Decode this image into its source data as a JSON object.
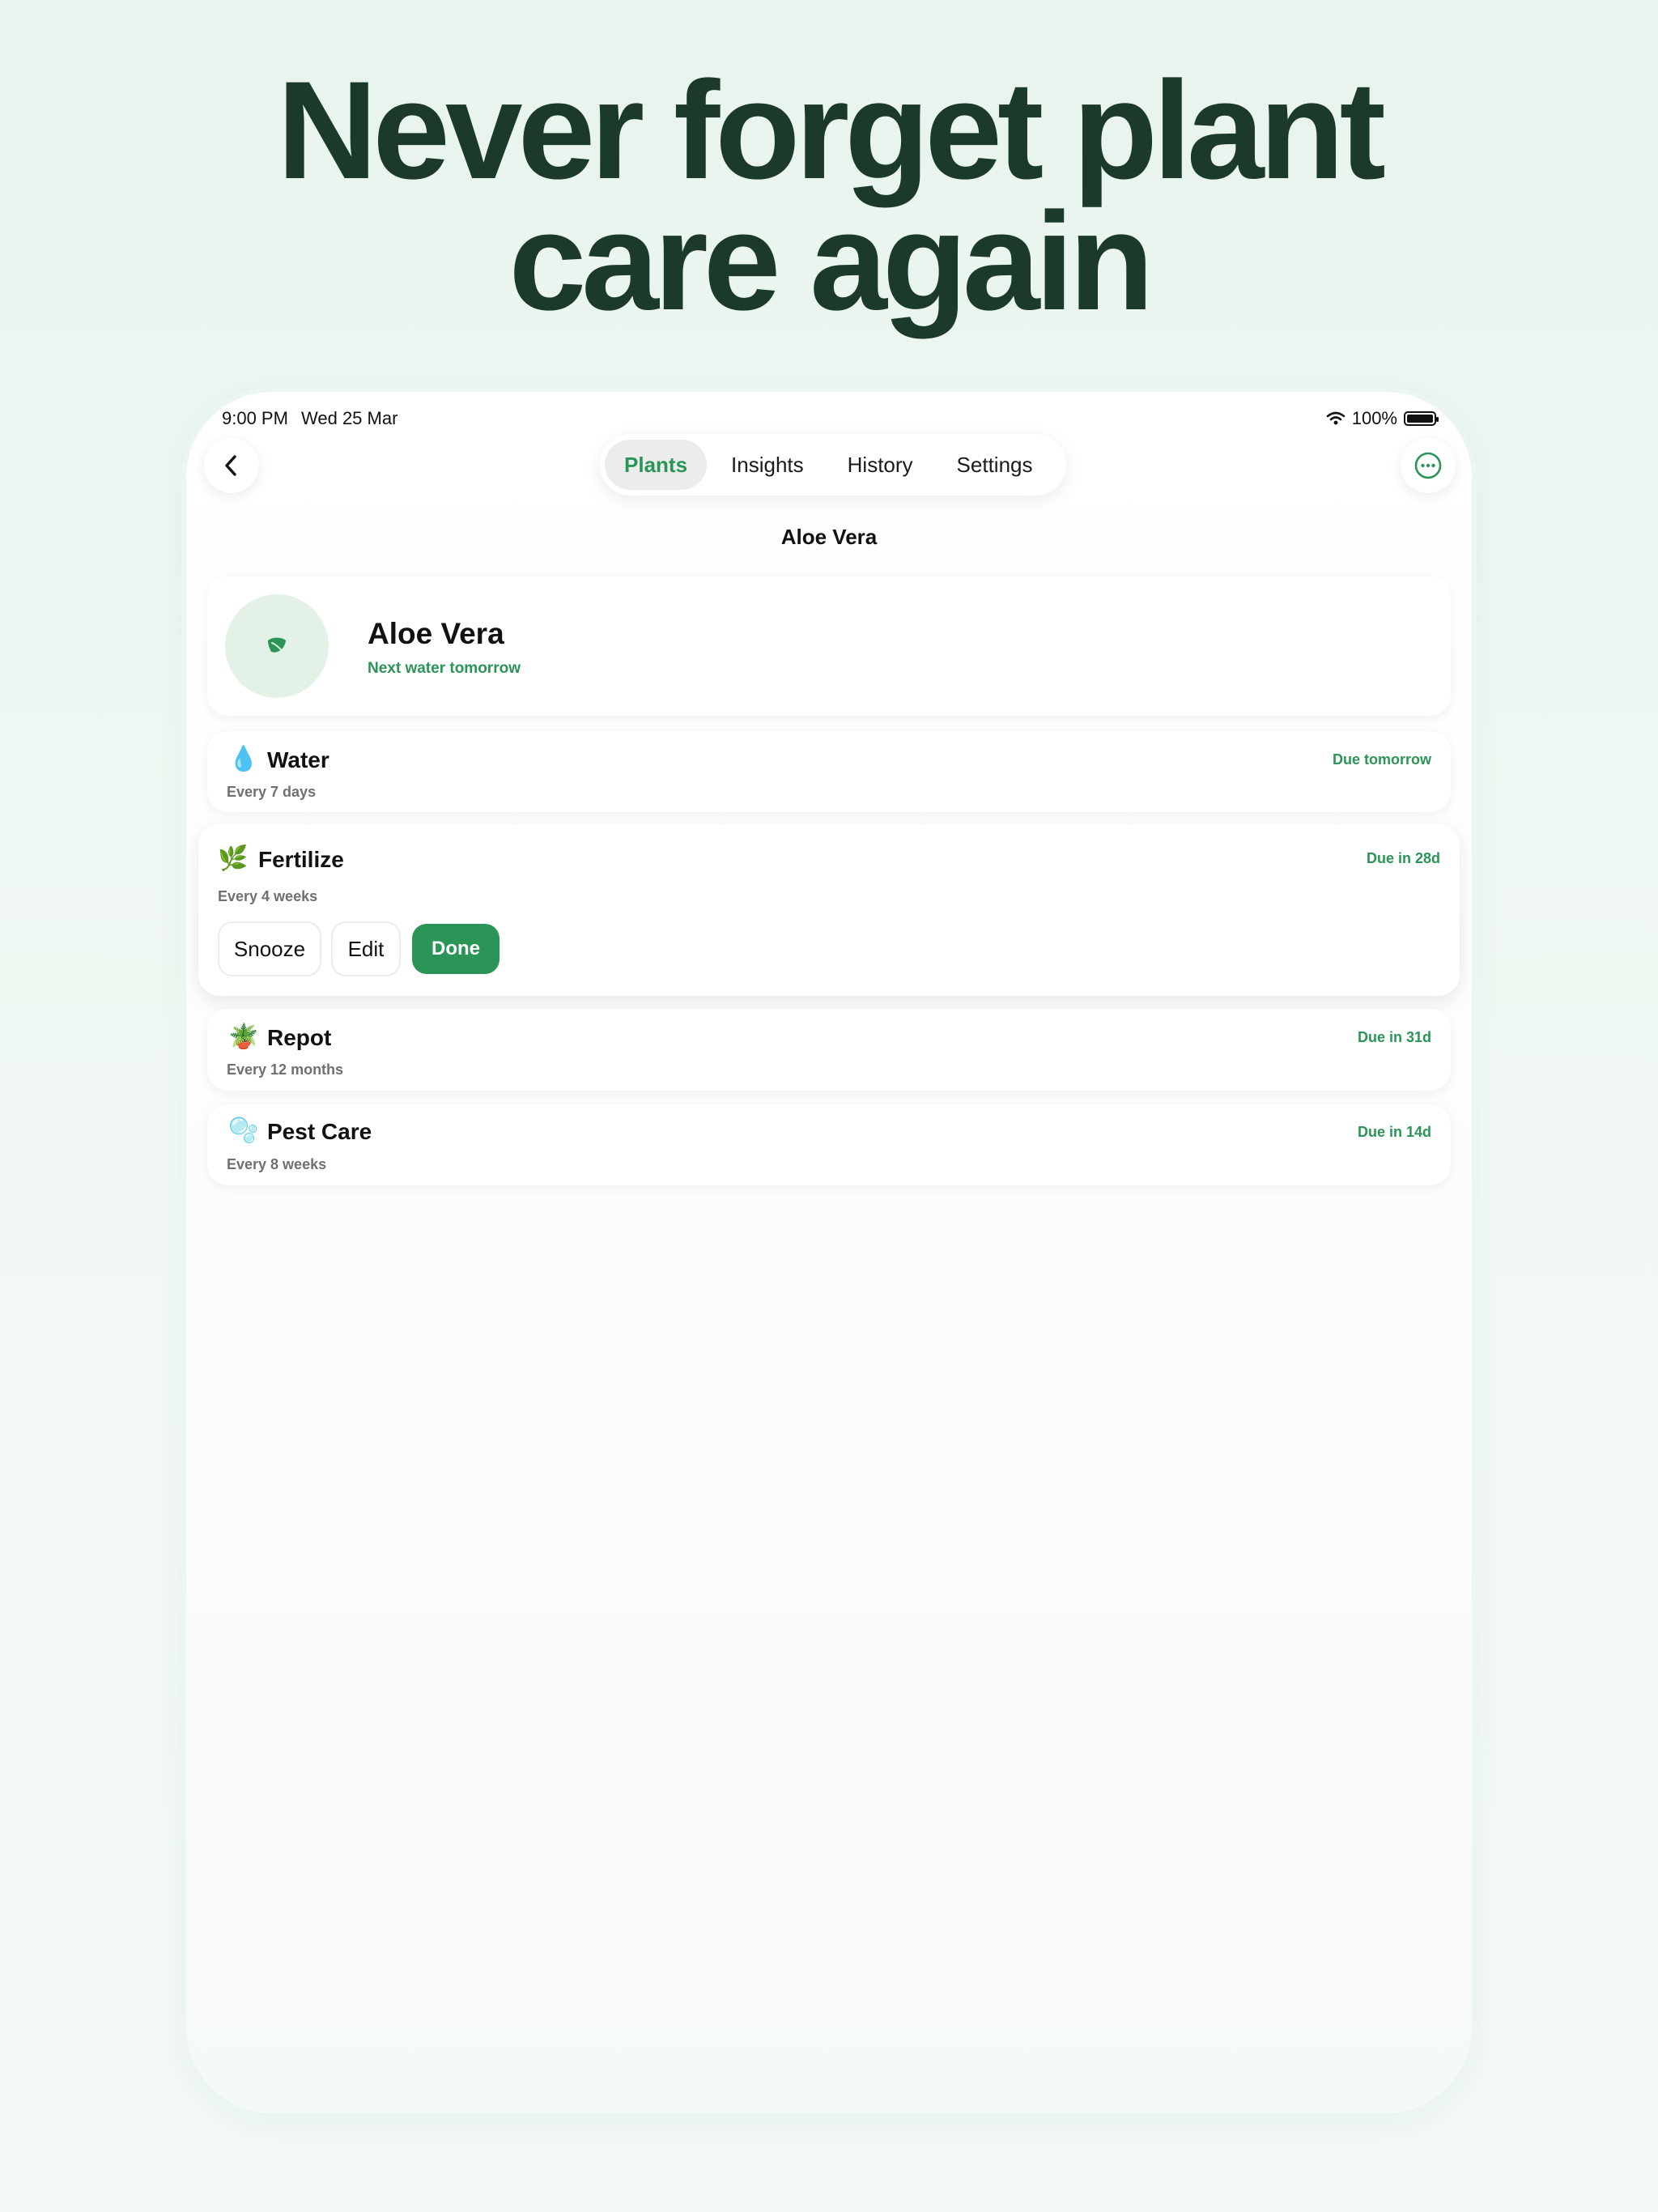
{
  "headline": {
    "line1": "Never forget plant",
    "line2": "care again"
  },
  "status_bar": {
    "time": "9:00 PM",
    "date": "Wed 25 Mar",
    "battery": "100%"
  },
  "nav": {
    "back_icon": "chevron-left-icon",
    "more_icon": "ellipsis-circle-icon",
    "tabs": [
      {
        "label": "Plants",
        "active": true
      },
      {
        "label": "Insights",
        "active": false
      },
      {
        "label": "History",
        "active": false
      },
      {
        "label": "Settings",
        "active": false
      }
    ]
  },
  "page_title": "Aloe Vera",
  "plant": {
    "name": "Aloe Vera",
    "next": "Next water tomorrow",
    "icon": "leaf-icon"
  },
  "tasks": [
    {
      "emoji": "💧",
      "name": "Water",
      "frequency": "Every 7 days",
      "due": "Due tomorrow"
    },
    {
      "emoji": "🌿",
      "name": "Fertilize",
      "frequency": "Every 4 weeks",
      "due": "Due in 28d"
    },
    {
      "emoji": "🪴",
      "name": "Repot",
      "frequency": "Every 12 months",
      "due": "Due in 31d"
    },
    {
      "emoji": "🫧",
      "name": "Pest Care",
      "frequency": "Every 8 weeks",
      "due": "Due in 14d"
    }
  ],
  "actions": {
    "snooze": "Snooze",
    "edit": "Edit",
    "done": "Done"
  },
  "colors": {
    "accent": "#2a9556",
    "headline": "#1c3a29",
    "background": "#eef6f1"
  }
}
